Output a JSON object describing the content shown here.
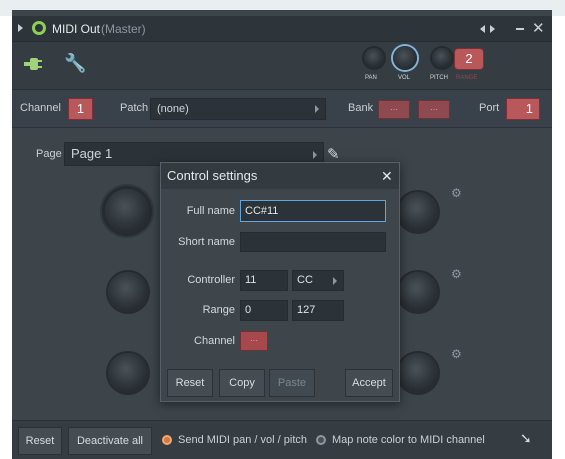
{
  "window": {
    "title": "MIDI Out",
    "subtitle": "(Master)"
  },
  "toolbar": {
    "pan_label": "PAN",
    "vol_label": "VOL",
    "pitch_label": "PITCH",
    "range_label": "RANGE",
    "range_value": "2"
  },
  "row": {
    "channel_label": "Channel",
    "channel_value": "1",
    "patch_label": "Patch",
    "patch_value": "(none)",
    "bank_label": "Bank",
    "bank_btn1": "···",
    "bank_btn2": "···",
    "port_label": "Port",
    "port_value": "1"
  },
  "page": {
    "label": "Page",
    "value": "Page 1"
  },
  "dialog": {
    "title": "Control settings",
    "fullname_label": "Full name",
    "fullname_value": "CC#11",
    "shortname_label": "Short name",
    "shortname_value": "",
    "controller_label": "Controller",
    "controller_value": "11",
    "controller_type": "CC",
    "range_label": "Range",
    "range_min": "0",
    "range_max": "127",
    "channel_label": "Channel",
    "channel_value": "···",
    "reset": "Reset",
    "copy": "Copy",
    "paste": "Paste",
    "accept": "Accept"
  },
  "bottom": {
    "reset": "Reset",
    "deactivate": "Deactivate all",
    "opt1": "Send MIDI pan / vol / pitch",
    "opt2": "Map note color to MIDI channel"
  },
  "colors": {
    "accent": "#9fd37a",
    "red": "#b8585b",
    "bg": "#3d454b"
  }
}
